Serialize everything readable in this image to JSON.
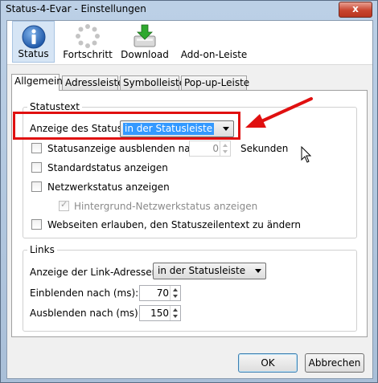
{
  "window": {
    "title": "Status-4-Evar - Einstellungen",
    "close_label": "x"
  },
  "toolbar": {
    "items": [
      {
        "label": "Status",
        "icon": "info-icon",
        "active": true
      },
      {
        "label": "Fortschritt",
        "icon": "spinner-icon",
        "active": false
      },
      {
        "label": "Download",
        "icon": "download-icon",
        "active": false
      },
      {
        "label": "Add-on-Leiste",
        "icon": "addon-bar-icon",
        "active": false
      }
    ]
  },
  "tabs": [
    "Allgemein",
    "Adressleiste",
    "Symbolleiste",
    "Pop-up-Leiste"
  ],
  "statustext": {
    "title": "Statustext",
    "status_label": "Anzeige des Status:",
    "status_value": "in der Statusleiste",
    "hide_label": "Statusanzeige ausblenden nach",
    "hide_value": "0",
    "seconds_label": "Sekunden",
    "default_label": "Standardstatus anzeigen",
    "network_label": "Netzwerkstatus anzeigen",
    "background_label": "Hintergrund-Netzwerkstatus anzeigen",
    "websites_label": "Webseiten erlauben, den Statuszeilentext zu ändern"
  },
  "links": {
    "title": "Links",
    "address_label": "Anzeige der Link-Adressen:",
    "address_value": "in der Statusleiste",
    "fadein_label": "Einblenden nach (ms):",
    "fadein_value": "70",
    "fadeout_label": "Ausblenden nach (ms):",
    "fadeout_value": "150"
  },
  "buttons": {
    "ok": "OK",
    "cancel": "Abbrechen"
  },
  "colors": {
    "annotation": "#e01010",
    "selection": "#3399ff"
  }
}
